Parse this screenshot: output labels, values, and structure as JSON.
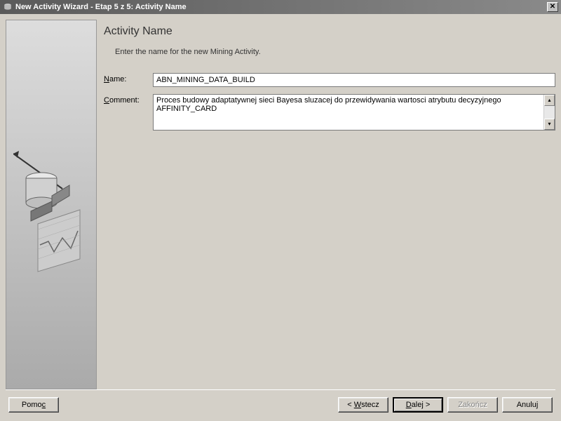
{
  "window": {
    "title": "New Activity Wizard - Etap 5 z 5: Activity Name"
  },
  "page": {
    "heading": "Activity Name",
    "subheading": "Enter the name for the new Mining Activity."
  },
  "form": {
    "name_label": "Name:",
    "name_value": "ABN_MINING_DATA_BUILD",
    "comment_label": "Comment:",
    "comment_value": "Proces budowy adaptatywnej sieci Bayesa sluzacej do przewidywania wartosci atrybutu decyzyjnego AFFINITY_CARD"
  },
  "buttons": {
    "help": "Pomoc",
    "back": "< Wstecz",
    "next": "Dalej >",
    "finish": "Zakończ",
    "cancel": "Anuluj"
  }
}
